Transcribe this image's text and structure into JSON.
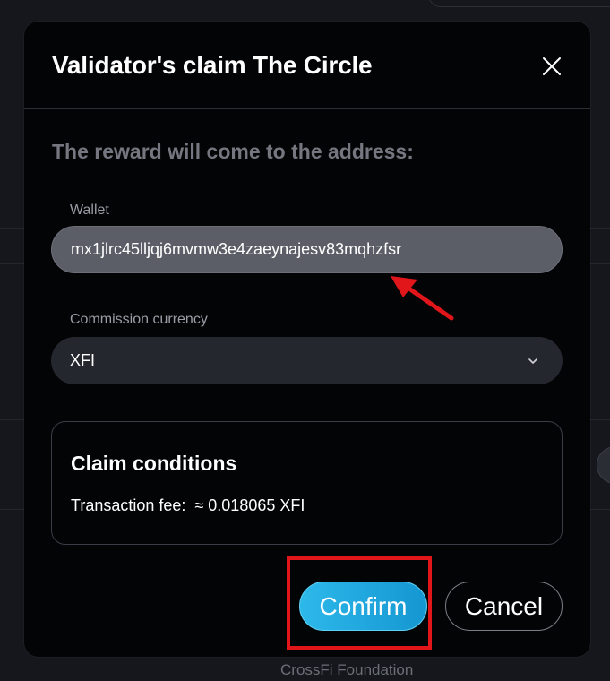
{
  "modal": {
    "title": "Validator's claim The Circle",
    "close_icon": "close-icon",
    "section_heading": "The reward will come to the address:",
    "wallet": {
      "label": "Wallet",
      "value": "mx1jlrc45lljqj6mvmw3e4zaeynajesv83mqhzfsr"
    },
    "commission_currency": {
      "label": "Commission currency",
      "selected": "XFI",
      "icon": "chevron-down-icon"
    },
    "claim_conditions": {
      "title": "Claim conditions",
      "fee_label": "Transaction fee:",
      "fee_value": "≈ 0.018065 XFI"
    },
    "buttons": {
      "confirm": "Confirm",
      "cancel": "Cancel"
    }
  },
  "background": {
    "footer_text": "CrossFi Foundation"
  },
  "annotations": {
    "arrow_color": "#e0161b",
    "highlight_color": "#e0161b"
  }
}
